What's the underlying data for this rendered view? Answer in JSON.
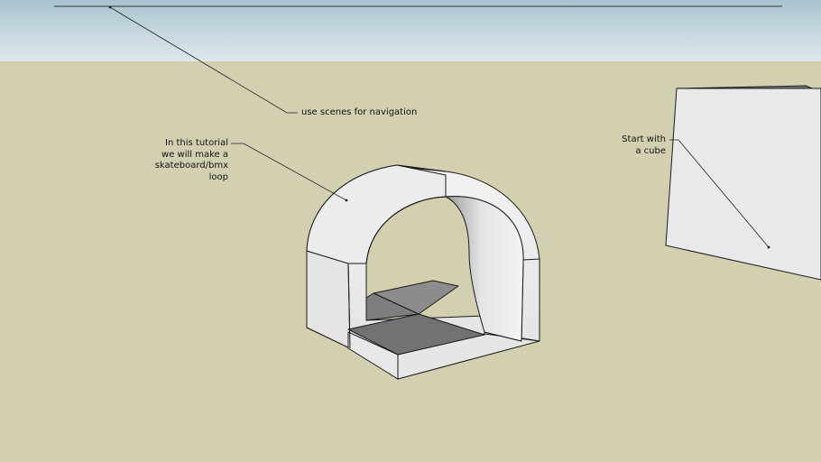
{
  "annotations": {
    "scenes": "use scenes for navigation",
    "tutorial": [
      "In this tutorial",
      "we will make a",
      "skateboard/bmx",
      "loop"
    ],
    "cube": [
      "Start with",
      "a cube"
    ]
  },
  "colors": {
    "sky_top": "#a8c4cf",
    "sky_bottom": "#dde7ea",
    "ground": "#d2d0b1",
    "face_light": "#ebebeb",
    "face_shadow": "#707070",
    "edge": "#1a1a1a"
  }
}
